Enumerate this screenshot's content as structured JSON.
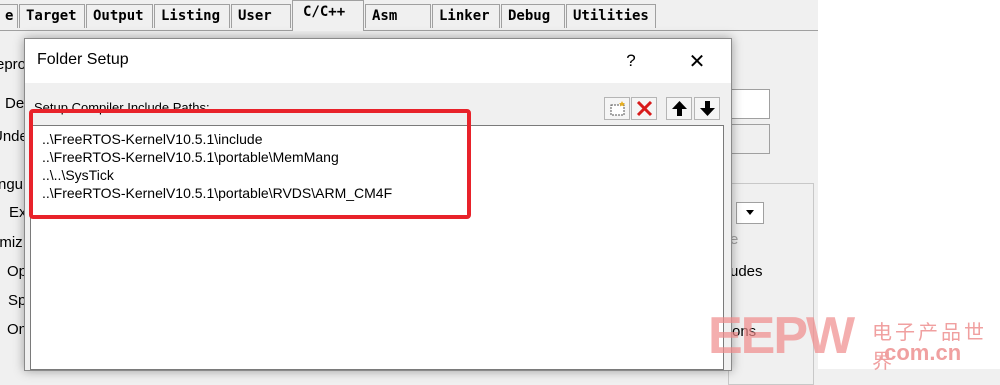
{
  "tabs": [
    "e",
    "Target",
    "Output",
    "Listing",
    "User",
    "C/C++",
    "Asm",
    "Linker",
    "Debug",
    "Utilities"
  ],
  "active_tab": "C/C++",
  "background": {
    "side_fragments": [
      "epro",
      "Def",
      "Undefi",
      "ngu",
      "Ex",
      "imiz",
      "Op",
      "Sp",
      "On"
    ],
    "right_fragments": [
      "e",
      "udes",
      "ons"
    ]
  },
  "dialog": {
    "title": "Folder Setup",
    "help_label": "?",
    "close_label": "✕",
    "list_header": "Setup Compiler Include Paths:",
    "toolbar": {
      "new_icon": "new-folder-icon",
      "delete_icon": "delete-icon",
      "move_up_icon": "arrow-up-icon",
      "move_down_icon": "arrow-down-icon",
      "delete_color": "#d81b1b"
    },
    "paths": [
      "..\\FreeRTOS-KernelV10.5.1\\include",
      "..\\FreeRTOS-KernelV10.5.1\\portable\\MemMang",
      "..\\..\\SysTick",
      "..\\FreeRTOS-KernelV10.5.1\\portable\\RVDS\\ARM_CM4F"
    ]
  },
  "highlight_color": "#e8222a",
  "watermark": {
    "logo": "EEPW",
    "cn": "电子产品世界",
    "url": ".com.cn"
  }
}
